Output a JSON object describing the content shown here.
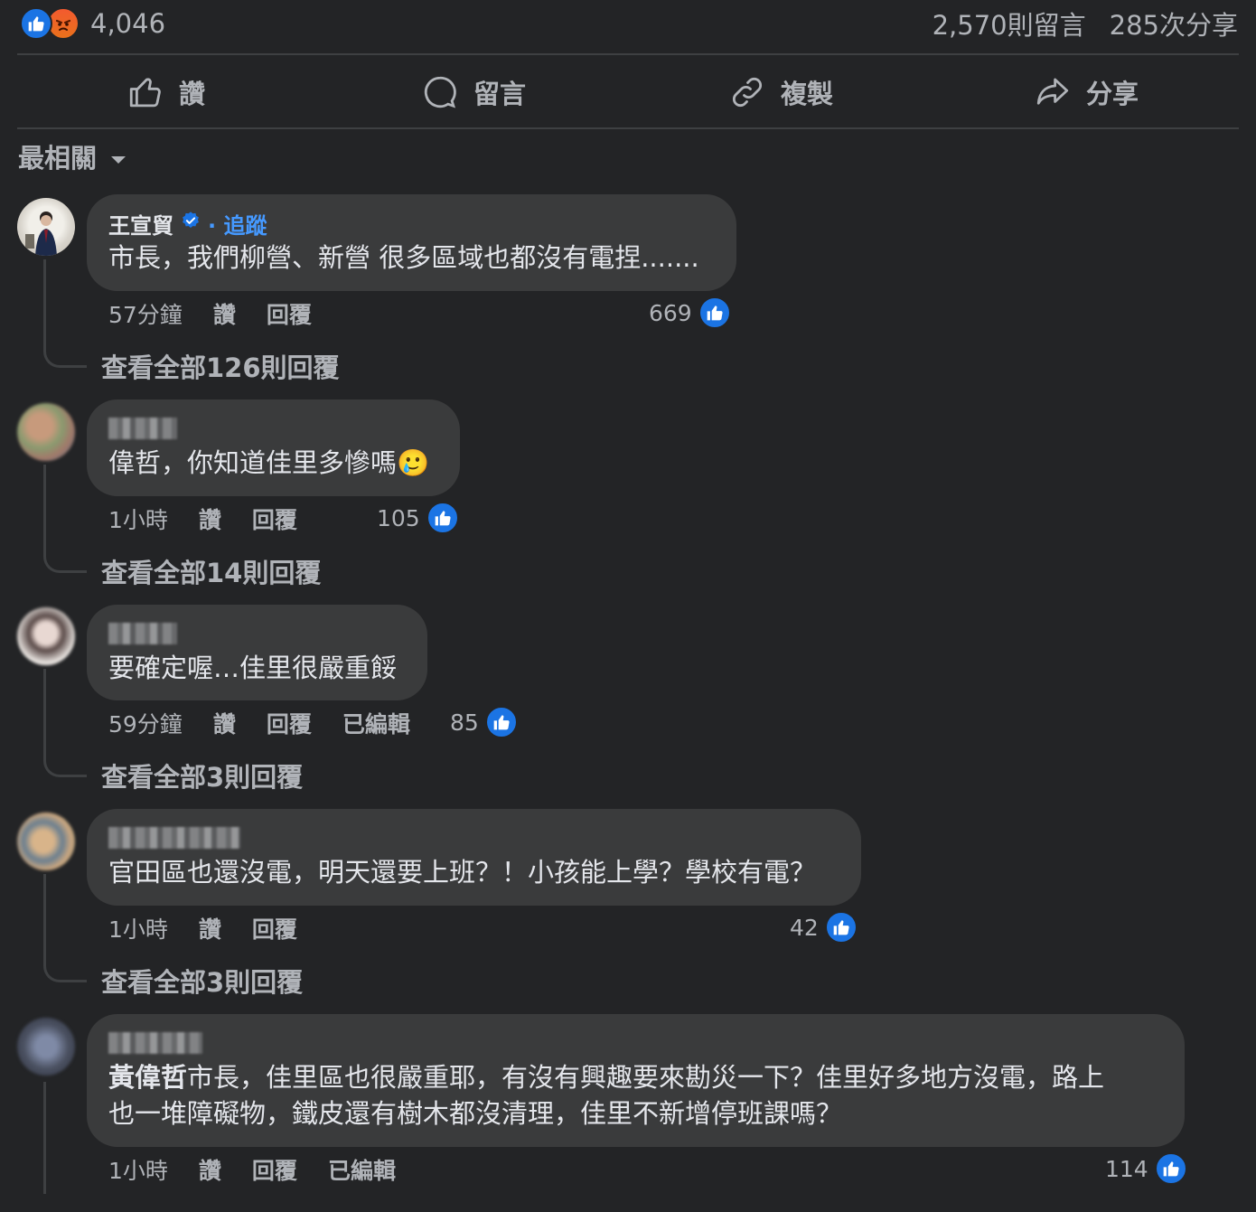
{
  "summary": {
    "reaction_icons": [
      "like-icon",
      "angry-icon"
    ],
    "reaction_count": "4,046",
    "comments": "2,570則留言",
    "shares": "285次分享"
  },
  "actions": [
    {
      "icon": "thumbs-up-outline-icon",
      "label": "讚"
    },
    {
      "icon": "comment-bubble-icon",
      "label": "留言"
    },
    {
      "icon": "link-icon",
      "label": "複製"
    },
    {
      "icon": "share-arrow-icon",
      "label": "分享"
    }
  ],
  "sort": {
    "label": "最相關",
    "icon": "caret-down-icon"
  },
  "comments": [
    {
      "author": "王宣貿",
      "verified": true,
      "follow": "· 追蹤",
      "text": "市長，我們柳營、新營 很多區域也都沒有電捏.......",
      "time": "57分鐘",
      "like_label": "讚",
      "reply_label": "回覆",
      "edited": "",
      "likes": "669",
      "view_replies": "查看全部126則回覆"
    },
    {
      "author": "",
      "text": "偉哲，你知道佳里多慘嗎🥲",
      "time": "1小時",
      "like_label": "讚",
      "reply_label": "回覆",
      "edited": "",
      "likes": "105",
      "view_replies": "查看全部14則回覆"
    },
    {
      "author": "",
      "text": "要確定喔…佳里很嚴重餒",
      "time": "59分鐘",
      "like_label": "讚",
      "reply_label": "回覆",
      "edited": "已編輯",
      "likes": "85",
      "view_replies": "查看全部3則回覆"
    },
    {
      "author": "",
      "text": "官田區也還沒電，明天還要上班？！小孩能上學？學校有電？",
      "time": "1小時",
      "like_label": "讚",
      "reply_label": "回覆",
      "edited": "",
      "likes": "42",
      "view_replies": "查看全部3則回覆"
    },
    {
      "author": "",
      "mention": "黃偉哲",
      "text_line1": "市長，佳里區也很嚴重耶，有沒有興趣要來勘災一下？佳里好多地方沒電，路上",
      "text_line2": "也一堆障礙物，鐵皮還有樹木都沒清理，佳里不新增停班課嗎？",
      "time": "1小時",
      "like_label": "讚",
      "reply_label": "回覆",
      "edited": "已編輯",
      "likes": "114"
    }
  ],
  "colors": {
    "background": "#232426",
    "bubble": "#3a3b3c",
    "accent": "#1b74e4",
    "link": "#4599ff"
  }
}
